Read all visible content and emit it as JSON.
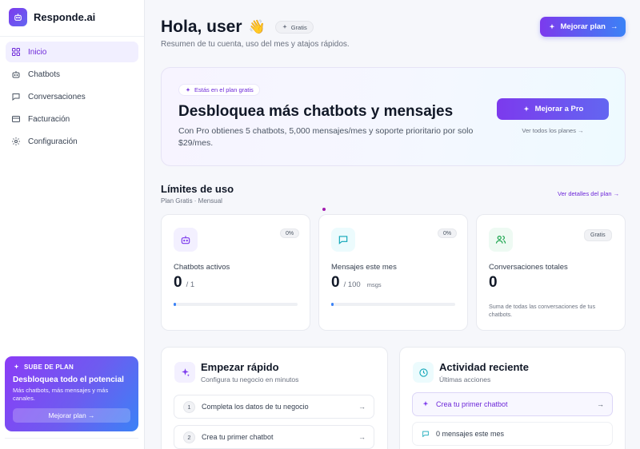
{
  "app": {
    "name": "Responde.ai"
  },
  "sidebar": {
    "items": [
      {
        "label": "Inicio",
        "icon": "grid-icon",
        "active": true
      },
      {
        "label": "Chatbots",
        "icon": "bot-icon",
        "active": false
      },
      {
        "label": "Conversaciones",
        "icon": "chat-icon",
        "active": false
      },
      {
        "label": "Facturación",
        "icon": "card-icon",
        "active": false
      },
      {
        "label": "Configuración",
        "icon": "gear-icon",
        "active": false
      }
    ],
    "promo": {
      "kicker": "SUBE DE PLAN",
      "title": "Desbloquea todo el potencial",
      "text": "Más chatbots, más mensajes y más canales.",
      "button": "Mejorar plan →"
    }
  },
  "header": {
    "greeting": "Hola, user",
    "emoji": "👋",
    "plan_badge": "Gratis",
    "subtitle": "Resumen de tu cuenta, uso del mes y atajos rápidos.",
    "upgrade_button": "Mejorar plan"
  },
  "hero": {
    "pill": "Estás en el plan gratis",
    "title": "Desbloquea más chatbots y mensajes",
    "text": "Con Pro obtienes 5 chatbots, 5,000 mensajes/mes y soporte prioritario por solo $29/mes.",
    "button": "Mejorar a Pro",
    "link": "Ver todos los planes →"
  },
  "usage": {
    "title": "Límites de uso",
    "subtitle": "Plan Gratis · Mensual",
    "details_link": "Ver detalles del plan",
    "cards": [
      {
        "label": "Chatbots activos",
        "value": "0",
        "limit": "/ 1",
        "unit": "",
        "tag": "0%",
        "progress": 0
      },
      {
        "label": "Mensajes este mes",
        "value": "0",
        "limit": "/ 100",
        "unit": "msgs",
        "tag": "0%",
        "progress": 0
      },
      {
        "label": "Conversaciones totales",
        "value": "0",
        "tag": "Gratis",
        "note": "Suma de todas las conversaciones de tus chatbots."
      }
    ]
  },
  "quickstart": {
    "title": "Empezar rápido",
    "subtitle": "Configura tu negocio en minutos",
    "steps": [
      {
        "num": "1",
        "label": "Completa los datos de tu negocio"
      },
      {
        "num": "2",
        "label": "Crea tu primer chatbot"
      }
    ]
  },
  "activity": {
    "title": "Actividad reciente",
    "subtitle": "Últimas acciones",
    "items": [
      {
        "label": "Crea tu primer chatbot"
      },
      {
        "label": "0 mensajes este mes"
      }
    ]
  },
  "colors": {
    "accent": "#7c3aed",
    "accent2": "#3b82f6",
    "teal": "#0ea5b7"
  }
}
